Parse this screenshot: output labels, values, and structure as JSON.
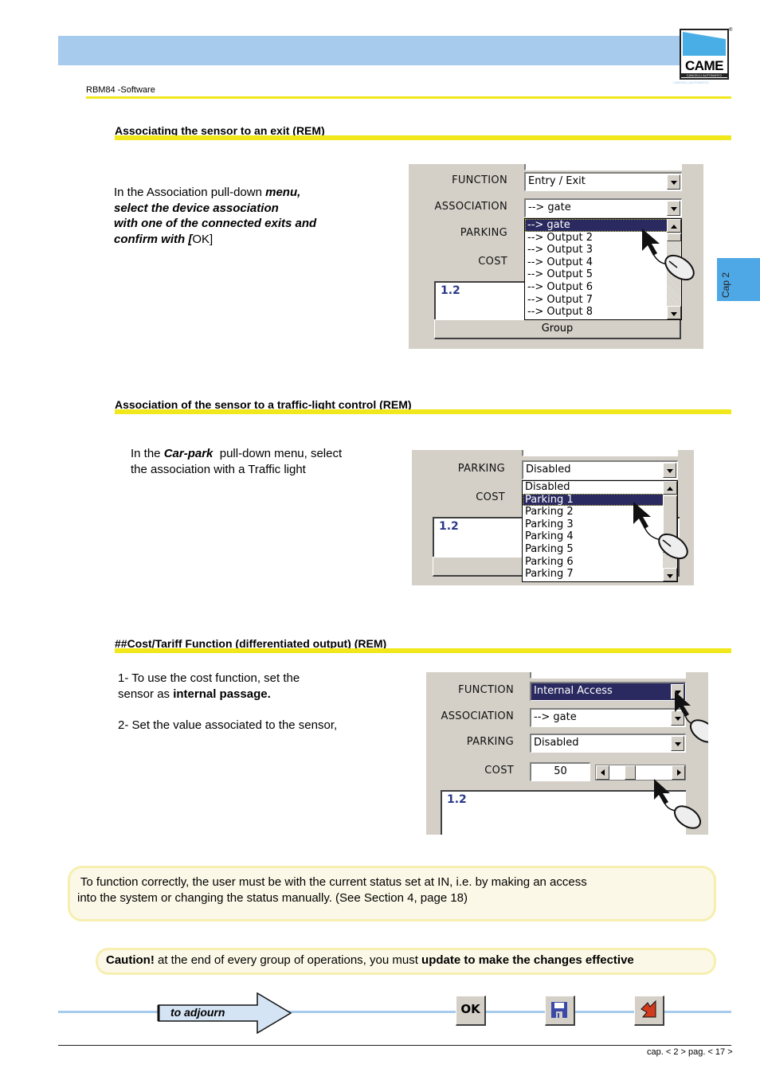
{
  "header": {
    "doc_name": "RBM84 -Software",
    "logo_text": "CAME",
    "logo_subtitle": "CANCELLI AUTOMATICI",
    "logo_registered": "®"
  },
  "side_tab": {
    "label": "Cap 2"
  },
  "sections": [
    {
      "title": "Associating the sensor to an exit (REM)",
      "text": {
        "line1_plain": "In the Association pull-down ",
        "line1_bold": "menu,",
        "line2_bold": "select the device association",
        "line3_bold": "with one of the connected exits and",
        "line4_bold": "confirm with [",
        "line4_ok": "OK",
        "line4_end": "]"
      },
      "dialog": {
        "labels": {
          "function": "FUNCTION",
          "association": "ASSOCIATION",
          "parking": "PARKING",
          "cost": "COST"
        },
        "function_value": "Entry / Exit",
        "association_value": "--> gate",
        "association_options": [
          "--> gate",
          "--> Output  2",
          "--> Output  3",
          "--> Output  4",
          "--> Output  5",
          "--> Output  6",
          "--> Output  7",
          "--> Output  8"
        ],
        "selected_option": "--> gate",
        "memo_value": "1.2",
        "group_button": "Group",
        "icons": [
          "mouse-pointer-icon",
          "mouse-icon"
        ]
      }
    },
    {
      "title": "Association of the sensor to a traffic-light control (REM)",
      "text": {
        "line1_plain": "In the ",
        "line1_bold": "Car-park",
        "line1_rest": "  pull-down menu, select",
        "line2": "the association with a Traffic light"
      },
      "dialog": {
        "labels": {
          "parking": "PARKING",
          "cost": "COST"
        },
        "parking_value": "Disabled",
        "parking_options": [
          "Disabled",
          "Parking 1",
          "Parking 2",
          "Parking 3",
          "Parking 4",
          "Parking 5",
          "Parking 6",
          "Parking 7"
        ],
        "selected_option": "Parking 1",
        "memo_value": "1.2"
      }
    },
    {
      "title": "##Cost/Tariff Function (differentiated output) (REM)",
      "text": {
        "step1_plain": "1- To use the cost function, set the",
        "step1_line2_plain": "sensor as ",
        "step1_line2_bold": "internal passage.",
        "step2": "2- Set the value associated to the sensor,"
      },
      "dialog": {
        "labels": {
          "function": "FUNCTION",
          "association": "ASSOCIATION",
          "parking": "PARKING",
          "cost": "COST"
        },
        "function_value": "Internal Access",
        "association_value": "--> gate",
        "parking_value": "Disabled",
        "cost_value": "50",
        "cost_slider_fraction": 0.3,
        "memo_value": "1.2"
      }
    }
  ],
  "notes": {
    "info_line1": " To function correctly, the user must be with the current status set at IN, i.e. by making an access",
    "info_line2": "into the system or changing the status manually. (See Section 4, page 18)",
    "caution_bold": "Caution!",
    "caution_plain": " at the end of every group of operations, you must ",
    "caution_bold2": "update to make the changes effective"
  },
  "footer": {
    "adjourn_label": "to adjourn",
    "ok_button": "OK",
    "save_icon": "floppy-disk-icon",
    "exit_icon": "exit-arrow-icon",
    "page_ref": "cap. < 2 > pag. < 17 >"
  }
}
